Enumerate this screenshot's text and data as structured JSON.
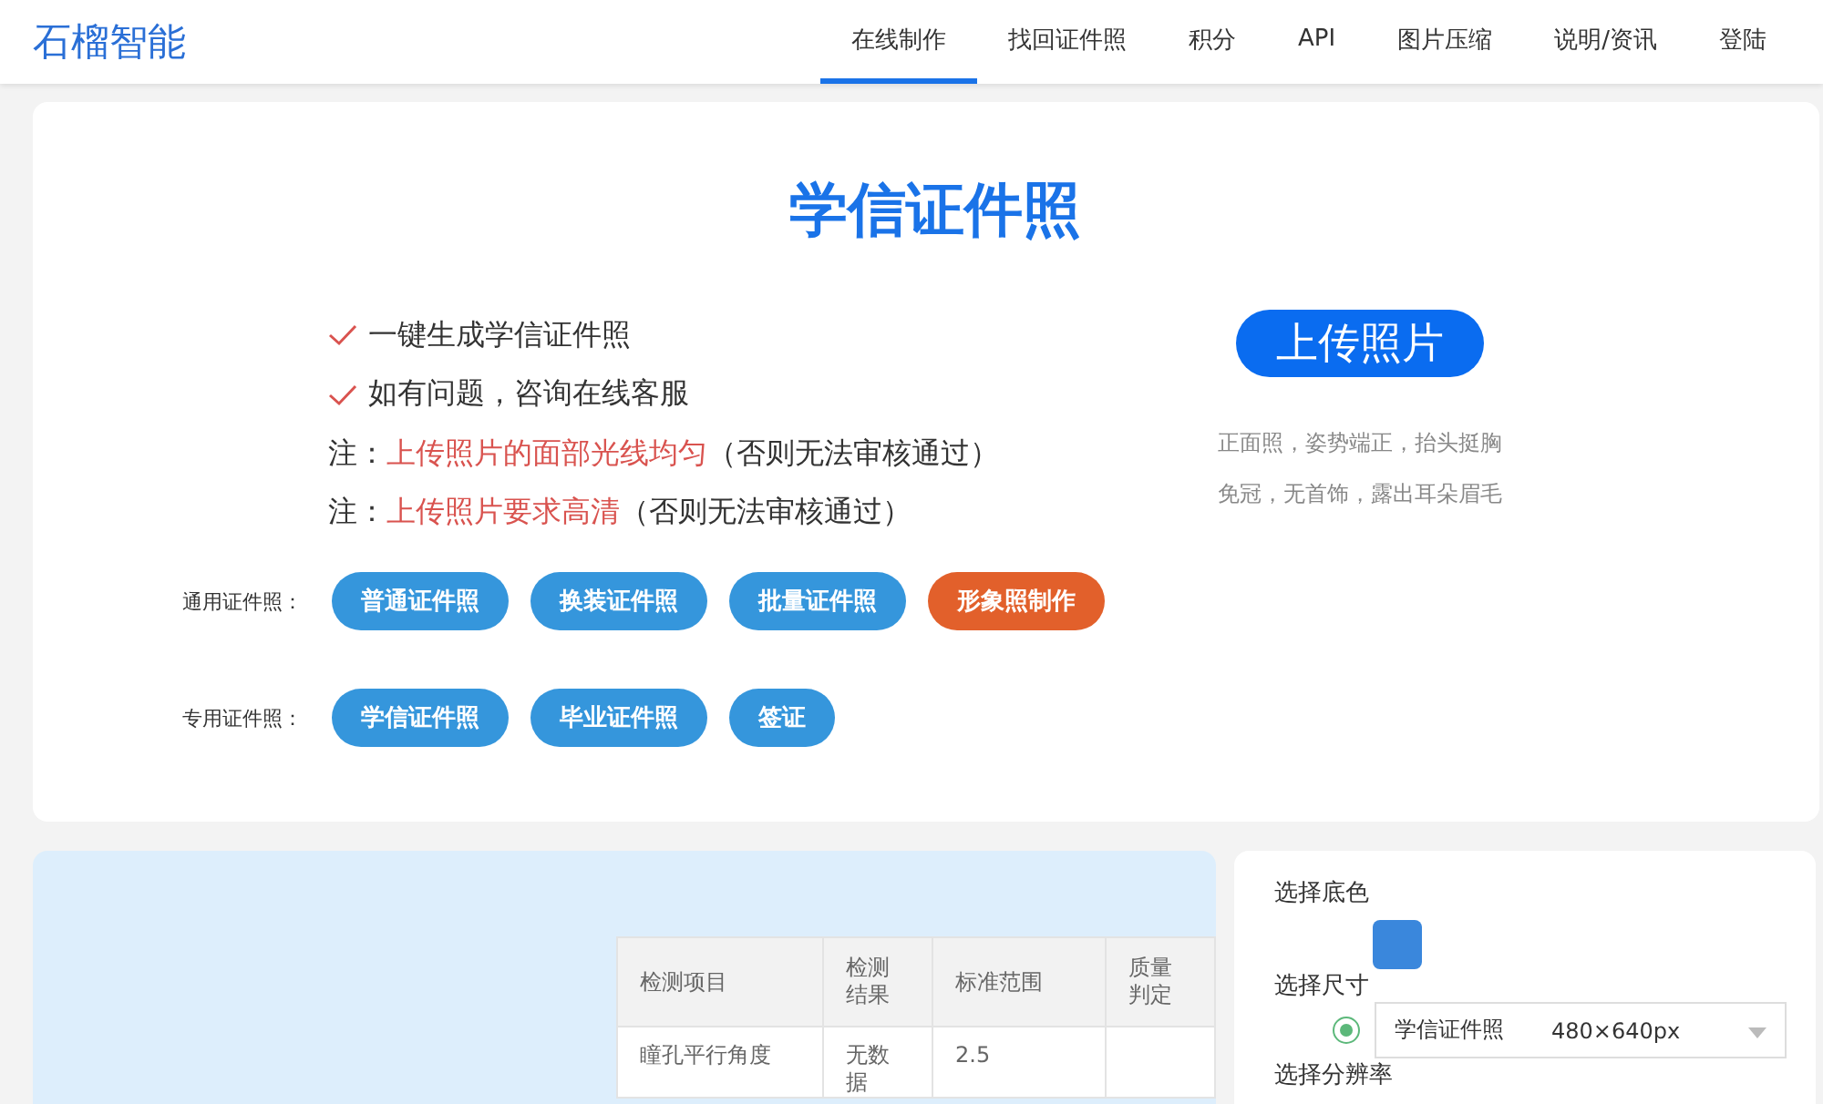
{
  "header": {
    "logo": "石榴智能",
    "nav": [
      {
        "label": "在线制作",
        "selected": true
      },
      {
        "label": "找回证件照",
        "selected": false
      },
      {
        "label": "积分",
        "selected": false
      },
      {
        "label": "API",
        "selected": false
      },
      {
        "label": "图片压缩",
        "selected": false
      },
      {
        "label": "说明/资讯",
        "selected": false
      },
      {
        "label": "登陆",
        "selected": false
      }
    ]
  },
  "hero": {
    "title": "学信证件照",
    "features": [
      {
        "kind": "check",
        "text": "一键生成学信证件照"
      },
      {
        "kind": "check",
        "text": "如有问题，咨询在线客服"
      },
      {
        "kind": "note",
        "prefix": "注：",
        "highlight": "上传照片的面部光线均匀",
        "suffix": "（否则无法审核通过）"
      },
      {
        "kind": "note",
        "prefix": "注：",
        "highlight": "上传照片要求高清",
        "suffix": "（否则无法审核通过）"
      }
    ],
    "upload_button": "上传照片",
    "tips": [
      "正面照，姿势端正，抬头挺胸",
      "免冠，无首饰，露出耳朵眉毛"
    ],
    "groups": [
      {
        "label": "通用证件照：",
        "buttons": [
          {
            "label": "普通证件照",
            "kind": "normal"
          },
          {
            "label": "换装证件照",
            "kind": "normal"
          },
          {
            "label": "批量证件照",
            "kind": "normal"
          },
          {
            "label": "形象照制作",
            "kind": "accent"
          }
        ]
      },
      {
        "label": "专用证件照：",
        "buttons": [
          {
            "label": "学信证件照",
            "kind": "normal"
          },
          {
            "label": "毕业证件照",
            "kind": "normal"
          },
          {
            "label": "签证",
            "kind": "normal"
          }
        ]
      }
    ]
  },
  "check_table": {
    "columns": [
      "检测项目",
      "检测结果",
      "标准范围",
      "质量判定"
    ],
    "rows": [
      [
        "瞳孔平行角度",
        "无数据",
        "2.5",
        ""
      ]
    ]
  },
  "options": {
    "background_label": "选择底色",
    "swatches": [
      {
        "color": "#3a87dc"
      }
    ],
    "size_label": "选择尺寸",
    "size": {
      "checked": true,
      "name": "学信证件照",
      "dims": "480×640px"
    },
    "resolution_label": "选择分辨率"
  }
}
